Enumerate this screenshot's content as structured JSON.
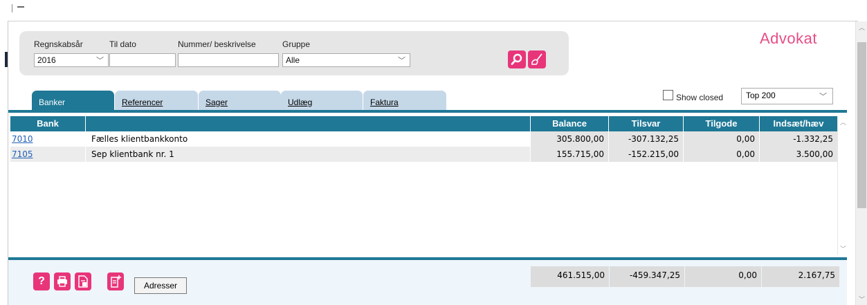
{
  "filters": {
    "year_label": "Regnskabsår",
    "year_value": "2016",
    "to_date_label": "Til dato",
    "to_date_value": "",
    "number_label": "Nummer/ beskrivelse",
    "number_value": "",
    "group_label": "Gruppe",
    "group_value": "Alle"
  },
  "brand": "Advokat",
  "tabs": [
    {
      "label": "Banker",
      "active": true
    },
    {
      "label": "Referencer",
      "active": false
    },
    {
      "label": "Sager",
      "active": false
    },
    {
      "label": "Udlæg",
      "active": false
    },
    {
      "label": "Faktura",
      "active": false
    }
  ],
  "show_closed_label": "Show closed",
  "top_select_value": "Top 200",
  "table": {
    "columns": [
      "Bank",
      "",
      "Balance",
      "Tilsvar",
      "Tilgode",
      "Indsæt/hæv"
    ],
    "rows": [
      {
        "bank": "7010",
        "desc": "Fælles klientbankkonto",
        "balance": "305.800,00",
        "tilsvar": "-307.132,25",
        "tilgode": "0,00",
        "indsaet": "-1.332,25"
      },
      {
        "bank": "7105",
        "desc": "Sep klientbank nr. 1",
        "balance": "155.715,00",
        "tilsvar": "-152.215,00",
        "tilgode": "0,00",
        "indsaet": "3.500,00"
      }
    ]
  },
  "totals": {
    "balance": "461.515,00",
    "tilsvar": "-459.347,25",
    "tilgode": "0,00",
    "indsaet": "2.167,75"
  },
  "footer": {
    "help_glyph": "?",
    "address_button": "Adresser"
  },
  "icons": [
    "search-icon",
    "broom-icon",
    "help-icon",
    "print-icon",
    "export-icon",
    "new-document-icon"
  ],
  "colors": {
    "accent": "#e8357a",
    "header": "#1f7896",
    "tab_inactive": "#c5d8e8",
    "brand": "#e64d86"
  }
}
